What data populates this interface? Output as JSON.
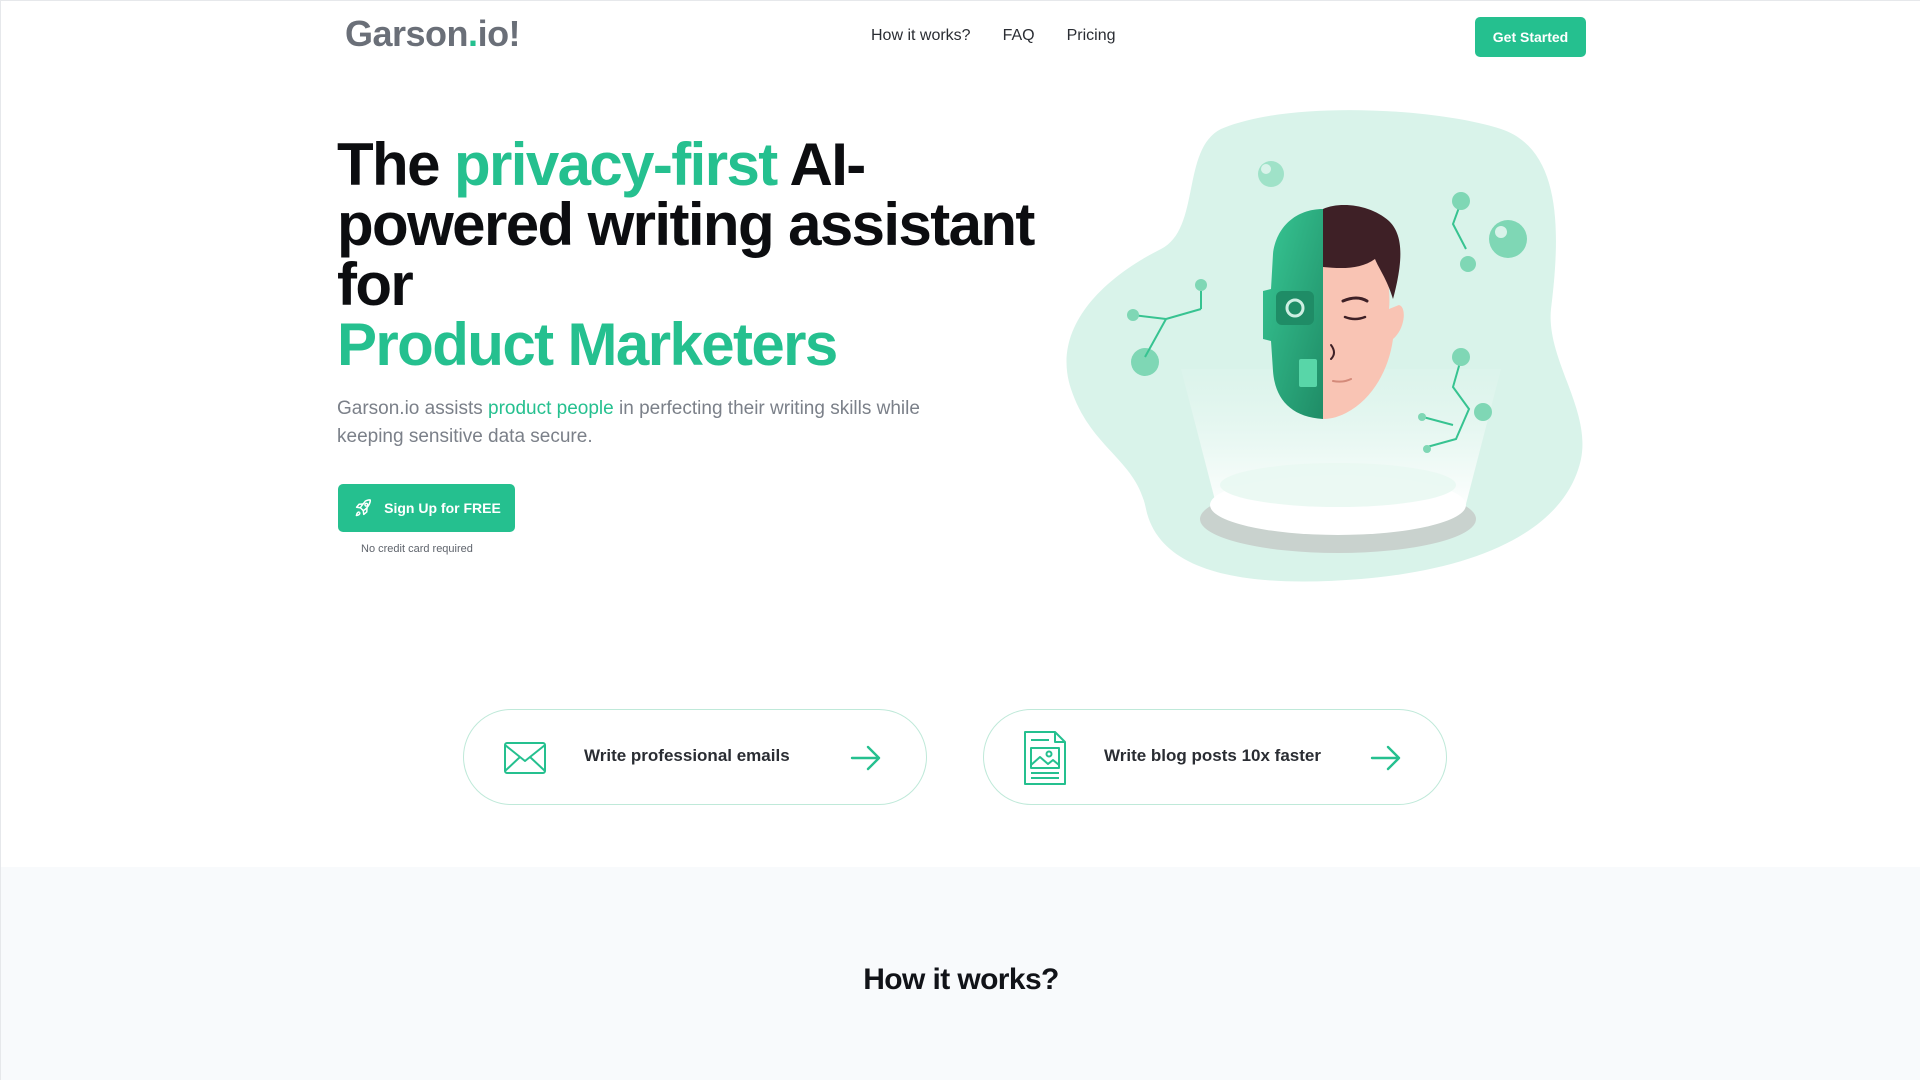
{
  "header": {
    "logo": {
      "part1": "Garson",
      "dot": ".",
      "part2": "io!"
    },
    "nav": [
      {
        "label": "How it works?"
      },
      {
        "label": "FAQ"
      },
      {
        "label": "Pricing"
      }
    ],
    "cta_label": "Get Started"
  },
  "hero": {
    "title": {
      "line1_pre": "The ",
      "line1_accent": "privacy-first",
      "line1_post": " AI-",
      "line2": "powered writing assistant",
      "line3": "for",
      "line4_accent": "Product Marketers"
    },
    "subtitle": {
      "pre": "Garson.io assists ",
      "accent": "product people",
      "post": " in perfecting their writing skills while keeping sensitive data secure."
    },
    "signup_label": "Sign Up for FREE",
    "signup_icon": "rocket-icon",
    "no_cc_note": "No credit card required"
  },
  "features": [
    {
      "label": "Write professional emails",
      "icon": "envelope-icon"
    },
    {
      "label": "Write blog posts 10x faster",
      "icon": "document-image-icon"
    }
  ],
  "how_it_works": {
    "title": "How it works?"
  },
  "colors": {
    "accent": "#25c08f",
    "accent_light": "#d9f3ea",
    "text_dark": "#0c0d10",
    "text_muted": "#7b8089",
    "section_bg": "#f8fafc"
  }
}
